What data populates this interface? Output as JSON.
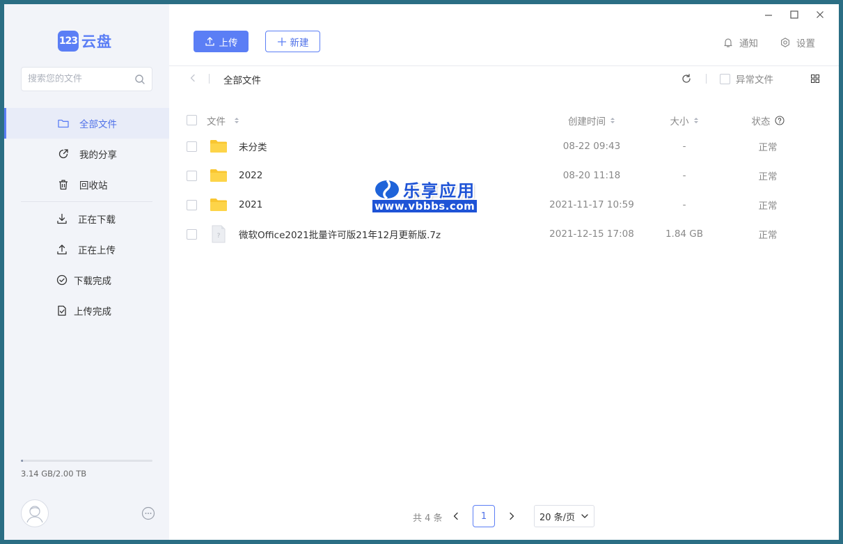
{
  "app": {
    "logo_badge": "123",
    "logo_name": "云盘",
    "brand_color": "#5b7ef5"
  },
  "sidebar": {
    "search_placeholder": "搜索您的文件",
    "nav": [
      {
        "label": "全部文件",
        "icon": "folder-icon",
        "active": true
      },
      {
        "label": "我的分享",
        "icon": "share-icon"
      },
      {
        "label": "回收站",
        "icon": "trash-icon"
      }
    ],
    "transfers": [
      {
        "label": "正在下载",
        "icon": "download-icon"
      },
      {
        "label": "正在上传",
        "icon": "upload-icon"
      },
      {
        "label": "下载完成",
        "icon": "check-circle-icon"
      },
      {
        "label": "上传完成",
        "icon": "file-check-icon"
      }
    ],
    "storage": {
      "text": "3.14 GB/2.00 TB",
      "used_fraction": 0.0016
    }
  },
  "toolbar": {
    "upload_label": "上传",
    "new_label": "新建",
    "notify_label": "通知",
    "settings_label": "设置"
  },
  "breadcrumb": {
    "current": "全部文件"
  },
  "filters": {
    "abnormal_label": "异常文件"
  },
  "table": {
    "headers": {
      "name": "文件",
      "time": "创建时间",
      "size": "大小",
      "status": "状态"
    },
    "rows": [
      {
        "name": "未分类",
        "type": "folder",
        "time": "08-22 09:43",
        "size": "-",
        "status": "正常"
      },
      {
        "name": "2022",
        "type": "folder",
        "time": "08-20 11:18",
        "size": "-",
        "status": "正常"
      },
      {
        "name": "2021",
        "type": "folder",
        "time": "2021-11-17 10:59",
        "size": "-",
        "status": "正常"
      },
      {
        "name": "微软Office2021批量许可版21年12月更新版.7z",
        "type": "file",
        "time": "2021-12-15 17:08",
        "size": "1.84 GB",
        "status": "正常"
      }
    ]
  },
  "watermark": {
    "title": "乐享应用",
    "url": "www.vbbbs.com"
  },
  "pagination": {
    "total": "共 4 条",
    "current_page": "1",
    "page_size": "20 条/页"
  }
}
